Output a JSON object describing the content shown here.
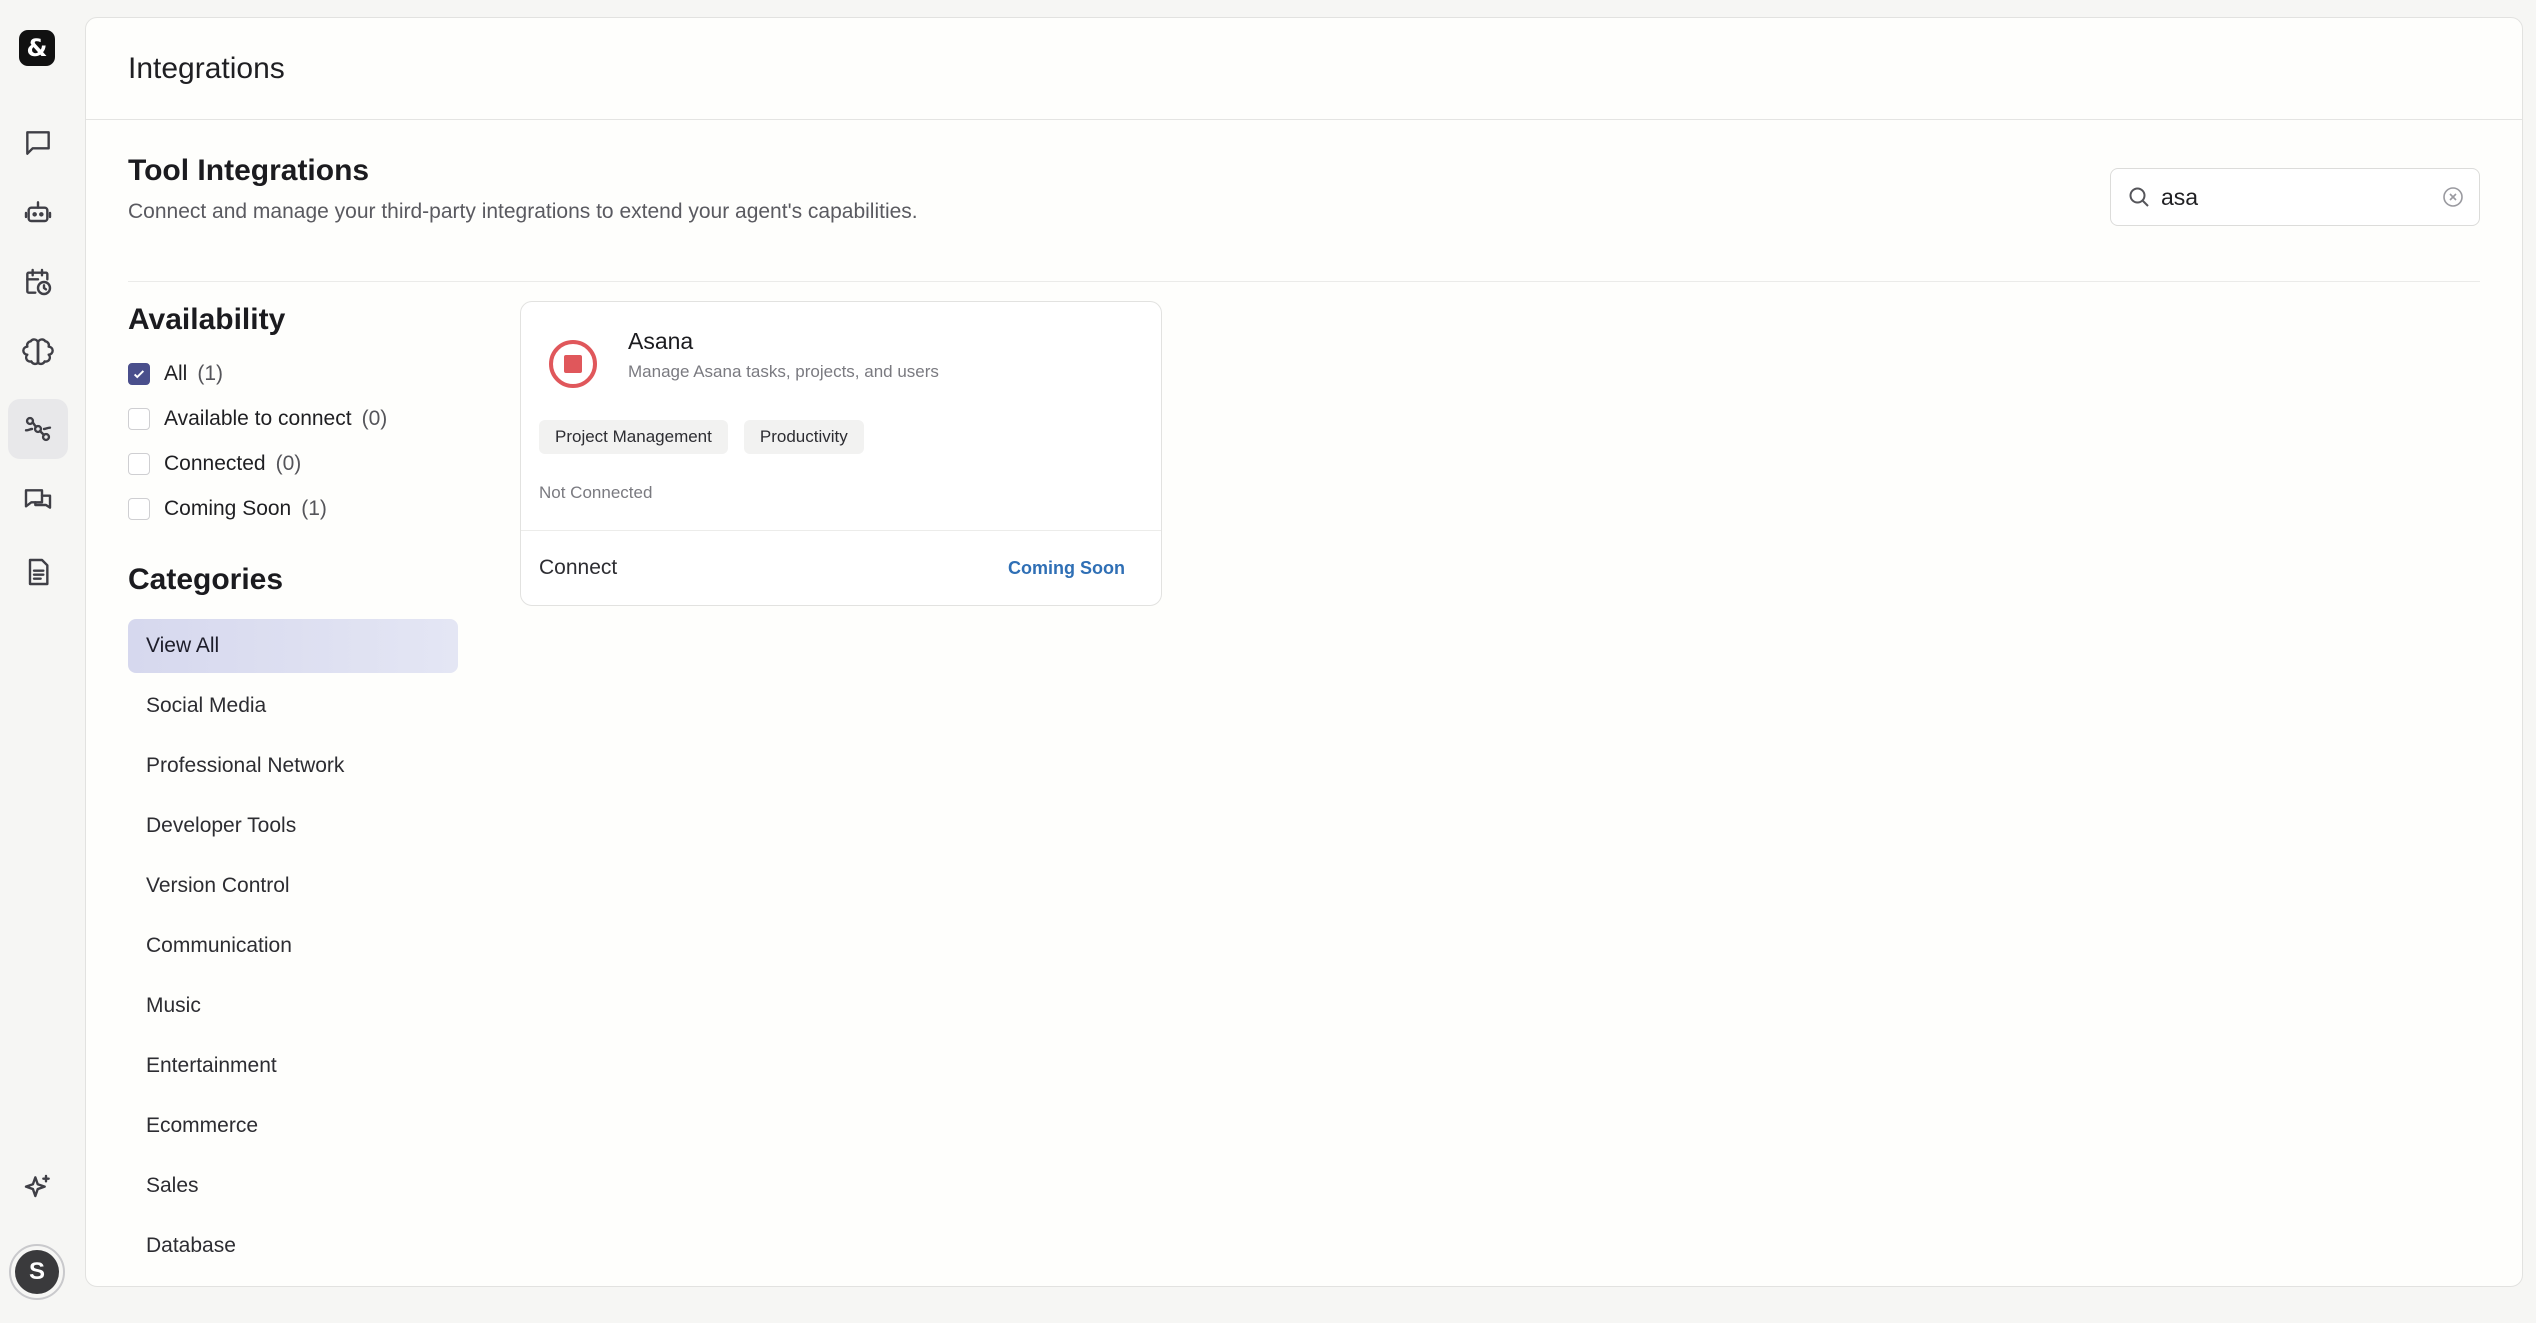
{
  "app": {
    "logo_text": "&"
  },
  "rail": {
    "items": [
      {
        "icon": "chat-icon"
      },
      {
        "icon": "robot-icon"
      },
      {
        "icon": "calendar-clock-icon"
      },
      {
        "icon": "brain-icon"
      },
      {
        "icon": "integrations-icon",
        "active": true
      },
      {
        "icon": "messages-icon"
      },
      {
        "icon": "document-icon"
      },
      {
        "icon": "sparkles-icon"
      }
    ],
    "avatar_initial": "S"
  },
  "header": {
    "title": "Integrations"
  },
  "section": {
    "title": "Tool Integrations",
    "subtitle": "Connect and manage your third-party integrations to extend your agent's capabilities."
  },
  "search": {
    "value": "asa"
  },
  "availability": {
    "title": "Availability",
    "options": [
      {
        "label": "All",
        "count": "(1)",
        "checked": true
      },
      {
        "label": "Available to connect",
        "count": "(0)",
        "checked": false
      },
      {
        "label": "Connected",
        "count": "(0)",
        "checked": false
      },
      {
        "label": "Coming Soon",
        "count": "(1)",
        "checked": false
      }
    ]
  },
  "categories": {
    "title": "Categories",
    "items": [
      "View All",
      "Social Media",
      "Professional Network",
      "Developer Tools",
      "Version Control",
      "Communication",
      "Music",
      "Entertainment",
      "Ecommerce",
      "Sales",
      "Database"
    ],
    "active": "View All"
  },
  "cards": [
    {
      "title": "Asana",
      "description": "Manage Asana tasks, projects, and users",
      "tags": [
        "Project Management",
        "Productivity"
      ],
      "status": "Not Connected",
      "action": "Connect",
      "badge": "Coming Soon",
      "brand_color": "#e0575b"
    }
  ]
}
